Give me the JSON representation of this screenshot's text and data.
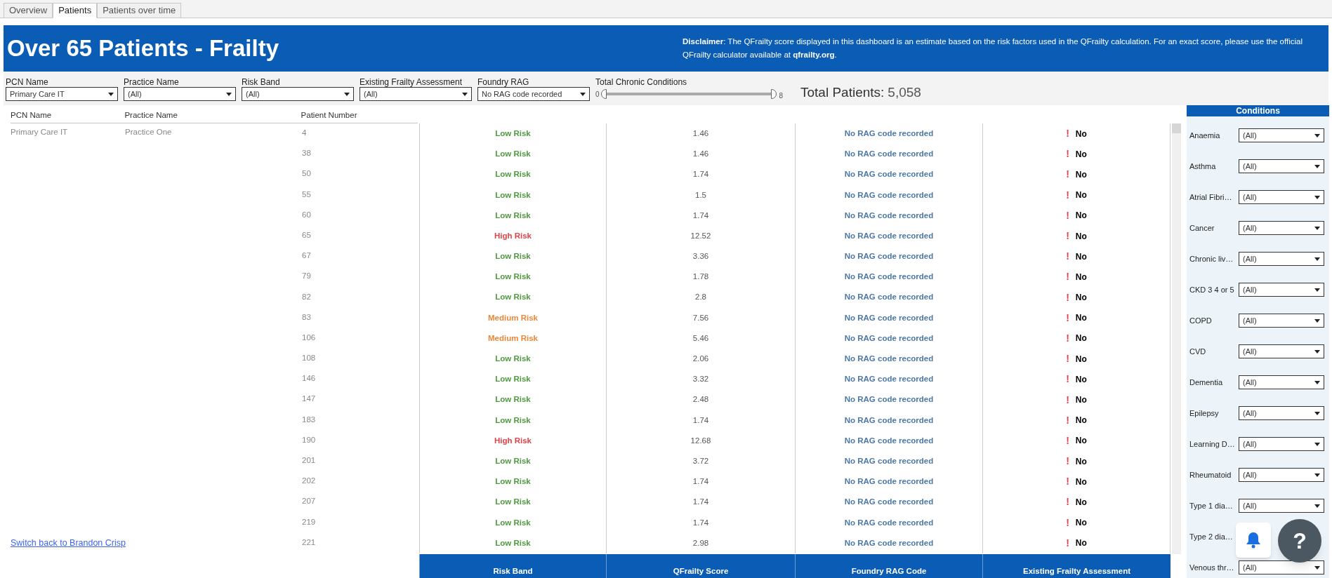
{
  "tabs": [
    {
      "label": "Overview",
      "selected": false
    },
    {
      "label": "Patients",
      "selected": true
    },
    {
      "label": "Patients over time",
      "selected": false
    }
  ],
  "header": {
    "title": "Over 65 Patients - Frailty",
    "disclaimer": "**Disclaimer**: The QFrailty score displayed in this dashboard is an estimate based on the risk factors used in the QFrailty calculation. For an exact score, please use the official QFrailty calculator available at **qfrailty.org**."
  },
  "filters": [
    {
      "label": "PCN Name",
      "value": "Primary Care IT"
    },
    {
      "label": "Practice Name",
      "value": "(All)"
    },
    {
      "label": "Risk Band",
      "value": "(All)"
    },
    {
      "label": "Existing Frailty Assessment",
      "value": "(All)"
    },
    {
      "label": "Foundry RAG",
      "value": "No RAG code recorded"
    }
  ],
  "slider": {
    "label": "Total Chronic Conditions",
    "min": "0",
    "max": "8",
    "level": 1
  },
  "total_patients": {
    "label": "Total Patients:",
    "value": "5,058"
  },
  "table": {
    "columns": [
      "PCN Name",
      "Practice Name",
      "Patient Number"
    ],
    "footer_columns": [
      "Risk Band",
      "QFrailty Score",
      "Foundry RAG Code",
      "Existing Frailty Assessment"
    ],
    "rows": [
      {
        "pcn_name": "Primary Care IT",
        "practice_name": "Practice One",
        "patient_number": "4",
        "risk_band": "Low Risk",
        "kind": "low",
        "score": "1.46",
        "rag": "No RAG code recorded",
        "alert": "!",
        "assessment": "No"
      },
      {
        "patient_number": "38",
        "risk_band": "Low Risk",
        "kind": "low",
        "score": "1.46",
        "rag": "No RAG code recorded",
        "alert": "!",
        "assessment": "No"
      },
      {
        "patient_number": "50",
        "risk_band": "Low Risk",
        "kind": "low",
        "score": "1.74",
        "rag": "No RAG code recorded",
        "alert": "!",
        "assessment": "No"
      },
      {
        "patient_number": "55",
        "risk_band": "Low Risk",
        "kind": "low",
        "score": "1.5",
        "rag": "No RAG code recorded",
        "alert": "!",
        "assessment": "No"
      },
      {
        "patient_number": "60",
        "risk_band": "Low Risk",
        "kind": "low",
        "score": "1.74",
        "rag": "No RAG code recorded",
        "alert": "!",
        "assessment": "No"
      },
      {
        "patient_number": "65",
        "risk_band": "High Risk",
        "kind": "high",
        "score": "12.52",
        "rag": "No RAG code recorded",
        "alert": "!",
        "assessment": "No"
      },
      {
        "patient_number": "67",
        "risk_band": "Low Risk",
        "kind": "low",
        "score": "3.36",
        "rag": "No RAG code recorded",
        "alert": "!",
        "assessment": "No"
      },
      {
        "patient_number": "79",
        "risk_band": "Low Risk",
        "kind": "low",
        "score": "1.78",
        "rag": "No RAG code recorded",
        "alert": "!",
        "assessment": "No"
      },
      {
        "patient_number": "82",
        "risk_band": "Low Risk",
        "kind": "low",
        "score": "2.8",
        "rag": "No RAG code recorded",
        "alert": "!",
        "assessment": "No"
      },
      {
        "patient_number": "83",
        "risk_band": "Medium Risk",
        "kind": "medium",
        "score": "7.56",
        "rag": "No RAG code recorded",
        "alert": "!",
        "assessment": "No"
      },
      {
        "patient_number": "106",
        "risk_band": "Medium Risk",
        "kind": "medium",
        "score": "5.46",
        "rag": "No RAG code recorded",
        "alert": "!",
        "assessment": "No"
      },
      {
        "patient_number": "108",
        "risk_band": "Low Risk",
        "kind": "low",
        "score": "2.06",
        "rag": "No RAG code recorded",
        "alert": "!",
        "assessment": "No"
      },
      {
        "patient_number": "146",
        "risk_band": "Low Risk",
        "kind": "low",
        "score": "3.32",
        "rag": "No RAG code recorded",
        "alert": "!",
        "assessment": "No"
      },
      {
        "patient_number": "147",
        "risk_band": "Low Risk",
        "kind": "low",
        "score": "2.48",
        "rag": "No RAG code recorded",
        "alert": "!",
        "assessment": "No"
      },
      {
        "patient_number": "183",
        "risk_band": "Low Risk",
        "kind": "low",
        "score": "1.74",
        "rag": "No RAG code recorded",
        "alert": "!",
        "assessment": "No"
      },
      {
        "patient_number": "190",
        "risk_band": "High Risk",
        "kind": "high",
        "score": "12.68",
        "rag": "No RAG code recorded",
        "alert": "!",
        "assessment": "No"
      },
      {
        "patient_number": "201",
        "risk_band": "Low Risk",
        "kind": "low",
        "score": "3.72",
        "rag": "No RAG code recorded",
        "alert": "!",
        "assessment": "No"
      },
      {
        "patient_number": "202",
        "risk_band": "Low Risk",
        "kind": "low",
        "score": "1.74",
        "rag": "No RAG code recorded",
        "alert": "!",
        "assessment": "No"
      },
      {
        "patient_number": "207",
        "risk_band": "Low Risk",
        "kind": "low",
        "score": "1.74",
        "rag": "No RAG code recorded",
        "alert": "!",
        "assessment": "No"
      },
      {
        "patient_number": "219",
        "risk_band": "Low Risk",
        "kind": "low",
        "score": "1.74",
        "rag": "No RAG code recorded",
        "alert": "!",
        "assessment": "No"
      },
      {
        "patient_number": "221",
        "risk_band": "Low Risk",
        "kind": "low",
        "score": "2.98",
        "rag": "No RAG code recorded",
        "alert": "!",
        "assessment": "No"
      }
    ]
  },
  "switch_link": "Switch back to Brandon Crisp",
  "conditions": {
    "title": "Conditions",
    "items": [
      {
        "label": "Anaemia",
        "value": "(All)"
      },
      {
        "label": "Asthma",
        "value": "(All)"
      },
      {
        "label": "Atrial Fibri…",
        "value": "(All)"
      },
      {
        "label": "Cancer",
        "value": "(All)"
      },
      {
        "label": "Chronic liv…",
        "value": "(All)"
      },
      {
        "label": "CKD 3 4 or 5",
        "value": "(All)"
      },
      {
        "label": "COPD",
        "value": "(All)"
      },
      {
        "label": "CVD",
        "value": "(All)"
      },
      {
        "label": "Dementia",
        "value": "(All)"
      },
      {
        "label": "Epilepsy",
        "value": "(All)"
      },
      {
        "label": "Learning D…",
        "value": "(All)"
      },
      {
        "label": "Rheumatoid",
        "value": "(All)"
      },
      {
        "label": "Type 1 dia…",
        "value": "(All)"
      },
      {
        "label": "Type 2 dia…"
      },
      {
        "label": "Venous thr…",
        "value": "(All)"
      }
    ]
  },
  "help_button": {
    "label": "?"
  }
}
